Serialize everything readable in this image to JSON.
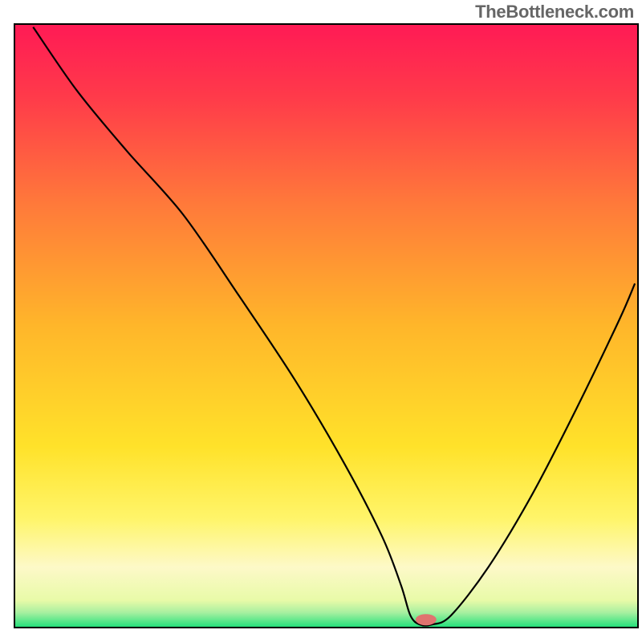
{
  "watermark": "TheBottleneck.com",
  "chart_data": {
    "type": "line",
    "title": "",
    "xlabel": "",
    "ylabel": "",
    "xlim": [
      0,
      100
    ],
    "ylim": [
      0,
      100
    ],
    "gradient_stops": [
      {
        "offset": 0.0,
        "color": "#ff1a55"
      },
      {
        "offset": 0.12,
        "color": "#ff3a4a"
      },
      {
        "offset": 0.3,
        "color": "#ff7a3a"
      },
      {
        "offset": 0.5,
        "color": "#ffb62a"
      },
      {
        "offset": 0.7,
        "color": "#ffe22a"
      },
      {
        "offset": 0.82,
        "color": "#fff56a"
      },
      {
        "offset": 0.9,
        "color": "#fdf9c8"
      },
      {
        "offset": 0.955,
        "color": "#e8faa8"
      },
      {
        "offset": 0.975,
        "color": "#a8f0a0"
      },
      {
        "offset": 1.0,
        "color": "#1ee07a"
      }
    ],
    "series": [
      {
        "name": "bottleneck-curve",
        "x": [
          3,
          10,
          18,
          27,
          36,
          45,
          53,
          59,
          62,
          63.5,
          65,
          67,
          70,
          76,
          83,
          90,
          97,
          99.5
        ],
        "y": [
          99.5,
          89,
          79,
          68.5,
          55,
          41,
          27,
          15,
          7,
          2,
          0.5,
          0.5,
          2,
          10,
          22,
          36,
          51,
          57
        ]
      }
    ],
    "marker": {
      "name": "optimal-point",
      "x": 66,
      "y": 1.3,
      "color": "#e0736f",
      "rx": 13,
      "ry": 7
    },
    "border": {
      "color": "#000000",
      "width": 2
    }
  }
}
